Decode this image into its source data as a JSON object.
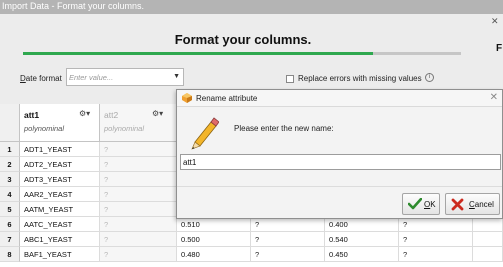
{
  "window": {
    "title": "Import Data - Format your columns.",
    "heading": "Format your columns.",
    "progress_fraction": 0.8
  },
  "options": {
    "date_format_label": "Date format",
    "date_format_placeholder": "Enter value...",
    "replace_errors_label": "Replace errors with missing values",
    "replace_errors_checked": false
  },
  "table": {
    "columns": [
      {
        "name": "att1",
        "type": "polynominal"
      },
      {
        "name": "att2",
        "type": "polynominal"
      }
    ],
    "rows": [
      {
        "num": "1",
        "att1": "ADT1_YEAST",
        "att2": "?"
      },
      {
        "num": "2",
        "att1": "ADT2_YEAST",
        "att2": "?"
      },
      {
        "num": "3",
        "att1": "ADT3_YEAST",
        "att2": "?"
      },
      {
        "num": "4",
        "att1": "AAR2_YEAST",
        "att2": "?"
      },
      {
        "num": "5",
        "att1": "AATM_YEAST",
        "att2": "?"
      },
      {
        "num": "6",
        "att1": "AATC_YEAST",
        "att2": "?",
        "c3": "0.510",
        "c4": "?",
        "c5": "0.400",
        "c6": "?"
      },
      {
        "num": "7",
        "att1": "ABC1_YEAST",
        "att2": "?",
        "c3": "0.500",
        "c4": "?",
        "c5": "0.540",
        "c6": "?"
      },
      {
        "num": "8",
        "att1": "BAF1_YEAST",
        "att2": "?",
        "c3": "0.480",
        "c4": "?",
        "c5": "0.450",
        "c6": "?"
      }
    ]
  },
  "dialog": {
    "title": "Rename attribute",
    "message": "Please enter the new name:",
    "input_value": "att1",
    "ok_label": "OK",
    "ok_mnemonic": "O",
    "ok_rest": "K",
    "cancel_label": "Cancel",
    "cancel_mnemonic": "C",
    "cancel_rest": "ancel"
  },
  "colors": {
    "progress": "#2fa84f",
    "ok_check": "#2e8b2e",
    "cancel_x": "#cc2a1e"
  }
}
